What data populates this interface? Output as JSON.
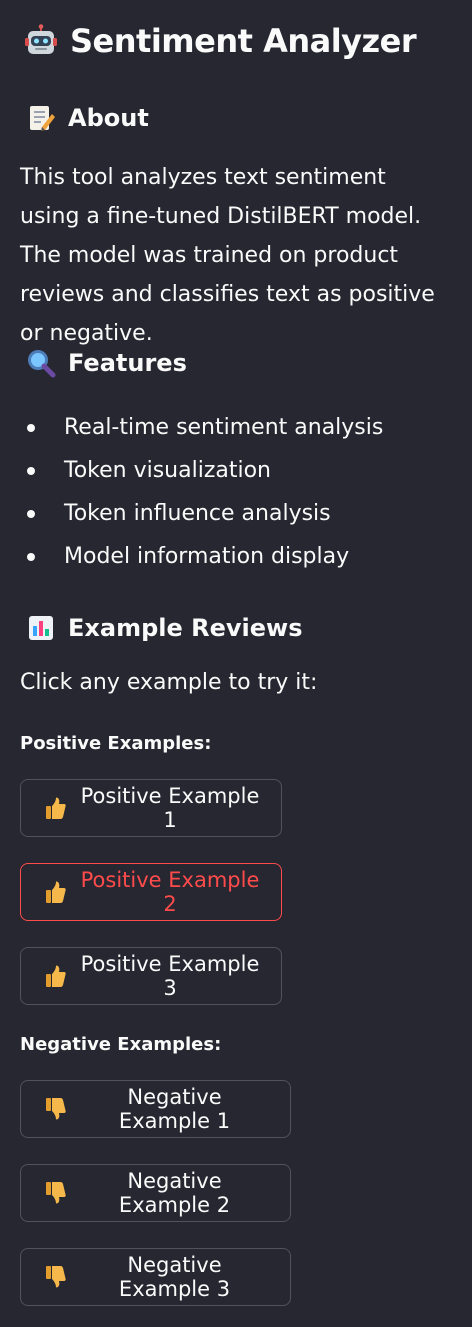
{
  "title": "Sentiment Analyzer",
  "about": {
    "heading": "About",
    "body": "This tool analyzes text sentiment using a fine-tuned DistilBERT model. The model was trained on product reviews and classifies text as positive or negative."
  },
  "features": {
    "heading": "Features",
    "items": [
      "Real-time sentiment analysis",
      "Token visualization",
      "Token influence analysis",
      "Model information display"
    ]
  },
  "examples": {
    "heading": "Example Reviews",
    "hint": "Click any example to try it:",
    "positive_label": "Positive Examples:",
    "negative_label": "Negative Examples:",
    "positive_buttons": [
      "Positive Example 1",
      "Positive Example 2",
      "Positive Example 3"
    ],
    "negative_buttons": [
      "Negative Example 1",
      "Negative Example 2",
      "Negative Example 3"
    ]
  },
  "icons": {
    "title": "robot-icon",
    "about": "memo-icon",
    "features": "magnifier-icon",
    "examples": "bar-chart-icon",
    "positive": "thumbs-up-icon",
    "negative": "thumbs-down-icon"
  },
  "colors": {
    "background": "#262730",
    "text": "#fafafa",
    "border": "#51525b",
    "accent": "#ff4b4b"
  }
}
